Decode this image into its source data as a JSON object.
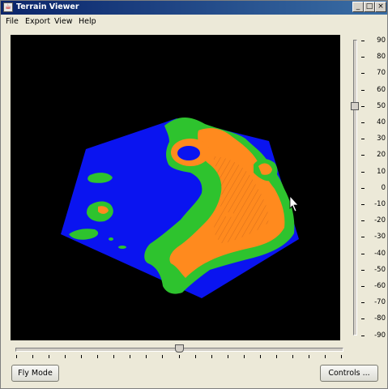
{
  "window": {
    "title": "Terrain Viewer",
    "controls": [
      "_",
      "□",
      "×"
    ]
  },
  "menu": [
    "File",
    "Export",
    "View",
    "Help"
  ],
  "viewport": {
    "background": "#000000",
    "terrain_colors": {
      "water": "#0a14f0",
      "lowland": "#2ec32e",
      "highland": "#ff8a1e"
    },
    "cursor": "arrow-cursor-icon"
  },
  "pitch_slider": {
    "value": 50,
    "min": -90,
    "max": 90,
    "labels": [
      "90",
      "80",
      "70",
      "60",
      "50",
      "40",
      "30",
      "20",
      "10",
      "0",
      "-10",
      "-20",
      "-30",
      "-40",
      "-50",
      "-60",
      "-70",
      "-80",
      "-90"
    ]
  },
  "heading_slider": {
    "value_fraction": 0.5,
    "ticks": 21
  },
  "buttons": {
    "fly_mode": "Fly Mode",
    "controls": "Controls ..."
  }
}
